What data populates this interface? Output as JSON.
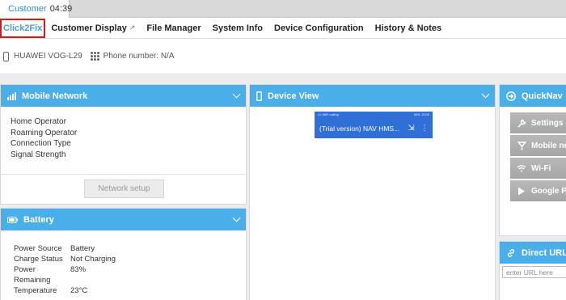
{
  "session_tab": {
    "name": "Customer",
    "time": "04:39"
  },
  "nav": {
    "items": [
      {
        "label": "Click2Fix",
        "active": true
      },
      {
        "label": "Customer Display",
        "external": true
      },
      {
        "label": "File Manager"
      },
      {
        "label": "System Info"
      },
      {
        "label": "Device Configuration"
      },
      {
        "label": "History & Notes"
      }
    ]
  },
  "device": {
    "model": "HUAWEI VOG-L29",
    "phone_label": "Phone number:",
    "phone_value": "N/A"
  },
  "mobile_network": {
    "title": "Mobile Network",
    "fields": [
      "Home Operator",
      "Roaming Operator",
      "Connection Type",
      "Signal Strength"
    ],
    "button": "Network setup"
  },
  "battery": {
    "title": "Battery",
    "rows": [
      {
        "label": "Power Source",
        "value": "Battery"
      },
      {
        "label": "Charge Status",
        "value": "Not Charging"
      },
      {
        "label": "Power Remaining",
        "value": "83%"
      },
      {
        "label": "Temperature",
        "value": "23°C"
      }
    ]
  },
  "device_view": {
    "title": "Device View",
    "status_left": "••• WiFi calling",
    "status_right": "83%  15:02",
    "app_title": "(Trial version) NAV HMS..."
  },
  "quicknav": {
    "title": "QuickNav",
    "items": [
      {
        "label": "Settings",
        "icon": "wrench-icon"
      },
      {
        "label": "Mobile ne",
        "icon": "antenna-icon"
      },
      {
        "label": "Wi-Fi",
        "icon": "wifi-icon"
      },
      {
        "label": "Google Pla",
        "icon": "play-icon"
      }
    ]
  },
  "direct_url": {
    "title": "Direct URL",
    "placeholder": "enter URL here"
  },
  "colors": {
    "accent": "#4aaee8",
    "active_nav": "#4a9ed6",
    "highlight_border": "#e01616",
    "phone_blue": "#2f6fd6"
  }
}
